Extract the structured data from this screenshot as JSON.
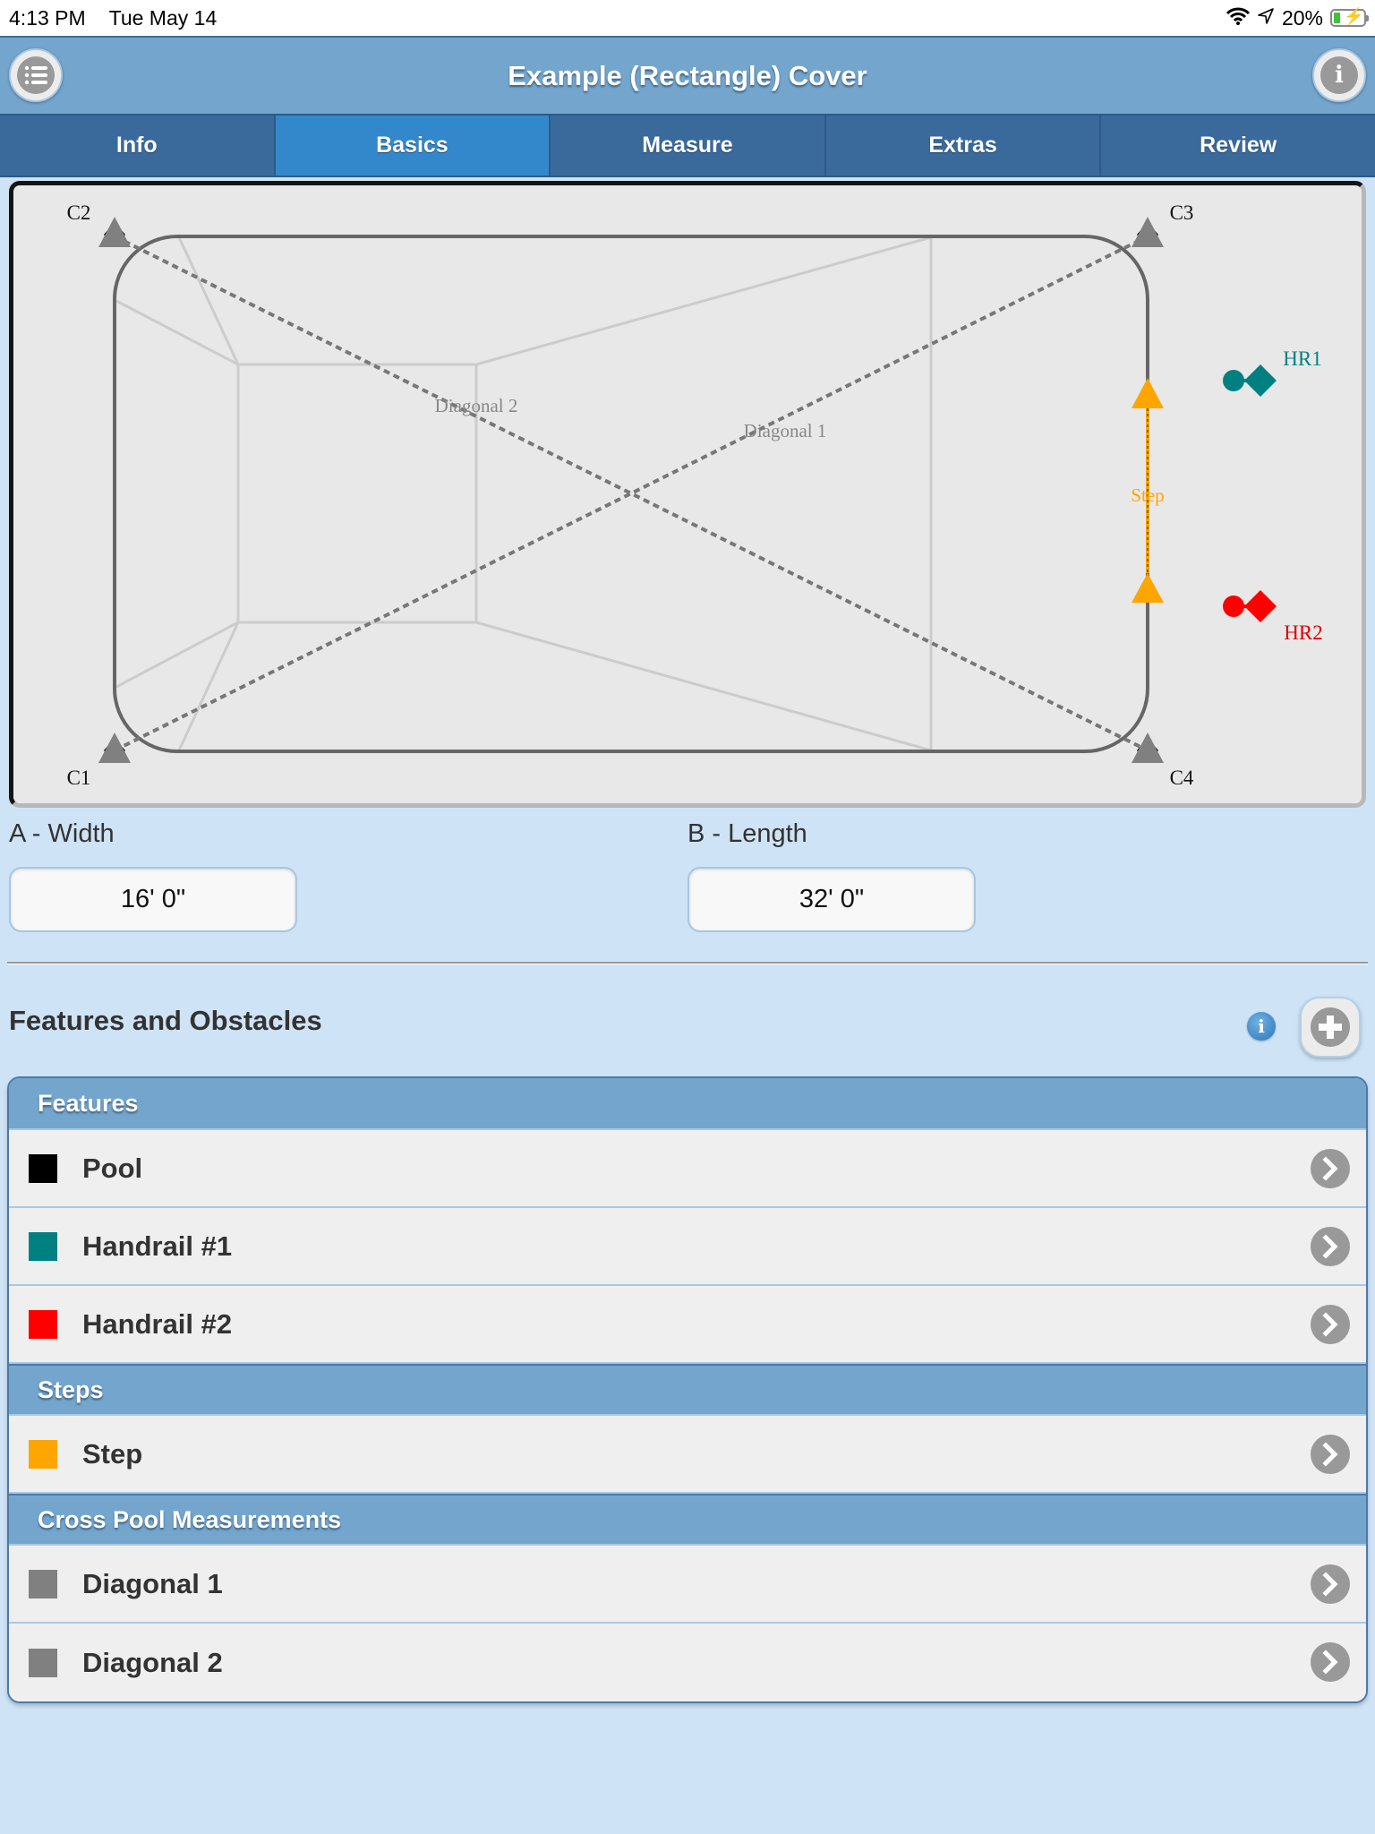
{
  "status_bar": {
    "time": "4:13 PM",
    "date": "Tue May 14",
    "battery_percent": "20%",
    "icons": [
      "wifi-icon",
      "location-icon",
      "battery-charging-icon"
    ]
  },
  "header": {
    "title": "Example (Rectangle) Cover",
    "left_button_icon": "list-menu-icon",
    "right_button_icon": "info-icon"
  },
  "tabs": [
    {
      "label": "Info",
      "active": false
    },
    {
      "label": "Basics",
      "active": true
    },
    {
      "label": "Measure",
      "active": false
    },
    {
      "label": "Extras",
      "active": false
    },
    {
      "label": "Review",
      "active": false
    }
  ],
  "diagram": {
    "corners": [
      "C1",
      "C2",
      "C3",
      "C4"
    ],
    "diagonal_labels": [
      "Diagonal 1",
      "Diagonal 2"
    ],
    "step_label": "Step",
    "handrails": [
      {
        "label": "HR1",
        "color": "#008080"
      },
      {
        "label": "HR2",
        "color": "#ff0000"
      }
    ],
    "colors": {
      "pool_outline": "#666666",
      "floor_lines": "#cccccc",
      "diagonal": "#777777",
      "corner_marker": "#808080",
      "step": "#ffa500"
    }
  },
  "dimensions": {
    "width_label": "A - Width",
    "width_value": "16' 0\"",
    "length_label": "B - Length",
    "length_value": "32' 0\""
  },
  "features_section": {
    "title": "Features and Obstacles",
    "info_icon": "info-icon",
    "add_icon": "plus-icon"
  },
  "groups": [
    {
      "header": "Features",
      "items": [
        {
          "label": "Pool",
          "color": "#000000"
        },
        {
          "label": "Handrail #1",
          "color": "#008080"
        },
        {
          "label": "Handrail #2",
          "color": "#ff0000"
        }
      ]
    },
    {
      "header": "Steps",
      "items": [
        {
          "label": "Step",
          "color": "#ffa500"
        }
      ]
    },
    {
      "header": "Cross Pool Measurements",
      "items": [
        {
          "label": "Diagonal 1",
          "color": "#808080"
        },
        {
          "label": "Diagonal 2",
          "color": "#808080"
        }
      ]
    }
  ]
}
